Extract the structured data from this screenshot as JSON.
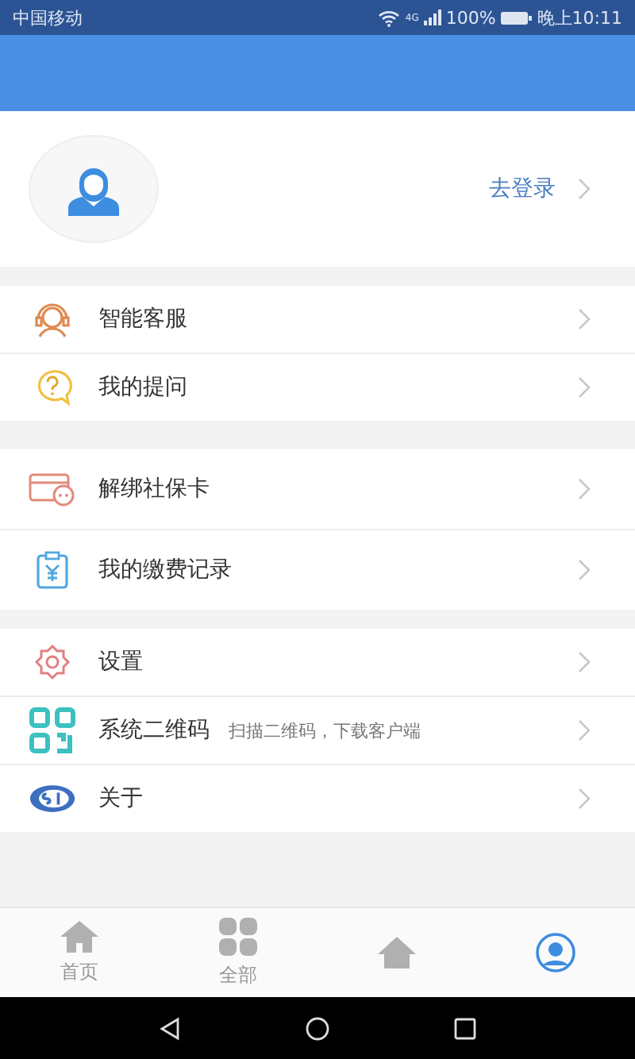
{
  "status_bar": {
    "carrier": "中国移动",
    "network": "4G",
    "battery": "100%",
    "time": "晚上10:11"
  },
  "profile": {
    "login": "去登录"
  },
  "menu_groups": [
    {
      "items": [
        {
          "label": "智能客服"
        },
        {
          "label": "我的提问"
        }
      ]
    },
    {
      "items": [
        {
          "label": "解绑社保卡"
        },
        {
          "label": "我的缴费记录"
        }
      ]
    },
    {
      "items": [
        {
          "label": "设置"
        },
        {
          "label": "系统二维码",
          "note": "扫描二维码，下载客户端"
        },
        {
          "label": "关于"
        }
      ]
    }
  ],
  "tab_bar": [
    {
      "label": "首页",
      "selected": false
    },
    {
      "label": "全部",
      "selected": false
    },
    {
      "selected": false
    },
    {
      "selected": true
    }
  ]
}
